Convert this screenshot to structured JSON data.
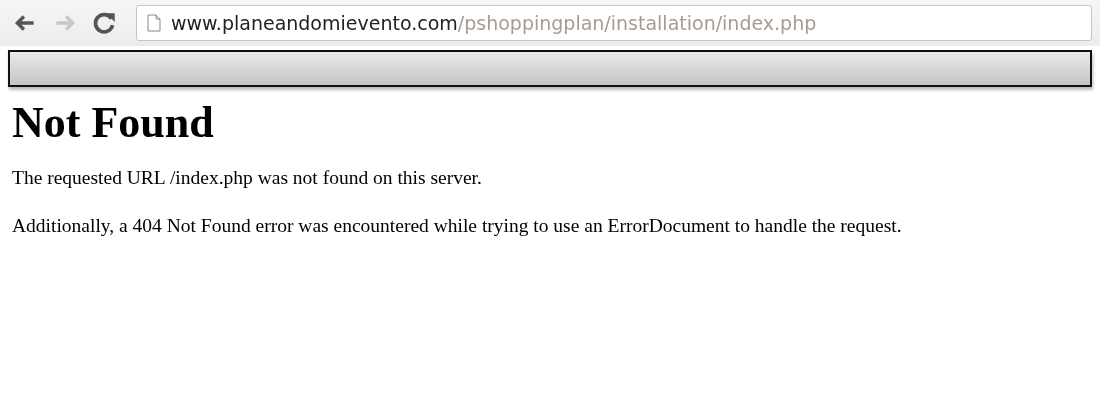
{
  "toolbar": {
    "back": {
      "disabled": false
    },
    "forward": {
      "disabled": true
    },
    "address": {
      "host": "www.planeandomievento.com",
      "path": "/pshoppingplan/installation/index.php"
    }
  },
  "page": {
    "heading": "Not Found",
    "paragraphs": [
      "The requested URL /index.php was not found on this server.",
      "Additionally, a 404 Not Found error was encountered while trying to use an ErrorDocument to handle the request."
    ]
  }
}
